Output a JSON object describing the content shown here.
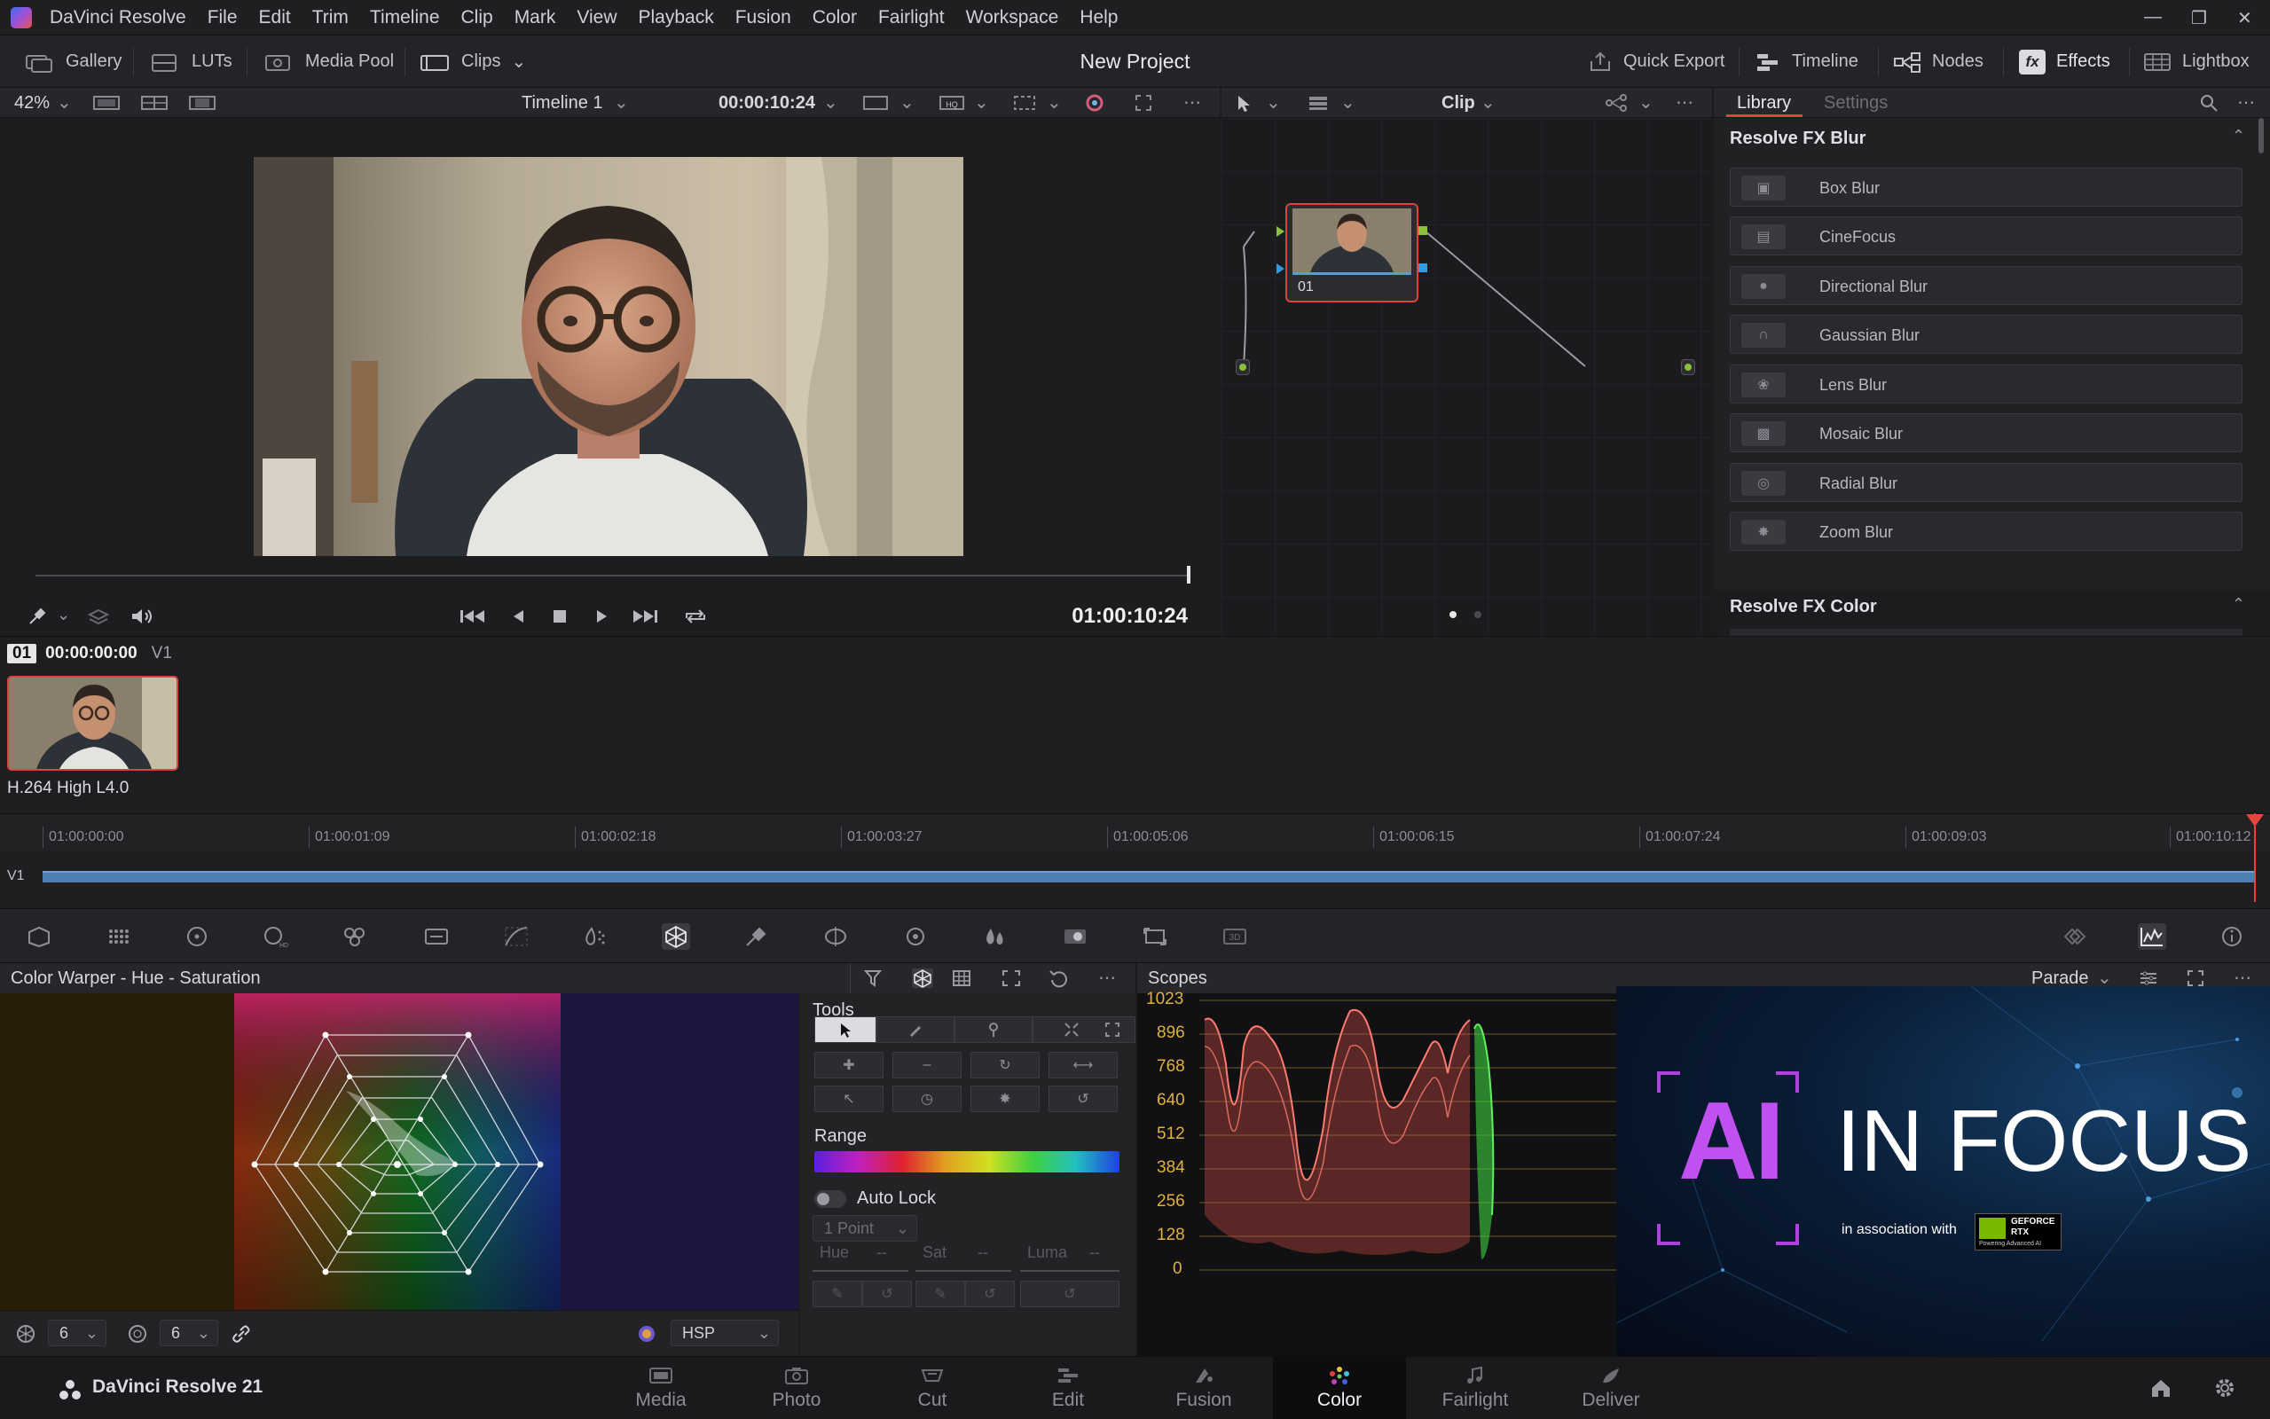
{
  "app": {
    "name": "DaVinci Resolve",
    "menus": [
      "DaVinci Resolve",
      "File",
      "Edit",
      "Trim",
      "Timeline",
      "Clip",
      "Mark",
      "View",
      "Playback",
      "Fusion",
      "Color",
      "Fairlight",
      "Workspace",
      "Help"
    ]
  },
  "toolbar": {
    "gallery": "Gallery",
    "luts": "LUTs",
    "media_pool": "Media Pool",
    "clips": "Clips",
    "project_title": "New Project",
    "quick_export": "Quick Export",
    "timeline": "Timeline",
    "nodes": "Nodes",
    "effects": "Effects",
    "lightbox": "Lightbox"
  },
  "viewer": {
    "zoom": "42%",
    "timeline_name": "Timeline 1",
    "source_tc": "00:00:10:24",
    "current_tc": "01:00:10:24",
    "scrub_position": 1.0
  },
  "nodes": {
    "mode": "Clip",
    "node_label": "01"
  },
  "library": {
    "tabs": [
      "Library",
      "Settings"
    ],
    "active_tab": "Library",
    "sections": [
      {
        "title": "Resolve FX Blur",
        "items": [
          "Box Blur",
          "CineFocus",
          "Directional Blur",
          "Gaussian Blur",
          "Lens Blur",
          "Mosaic Blur",
          "Radial Blur",
          "Zoom Blur"
        ]
      },
      {
        "title": "Resolve FX Color",
        "items": []
      }
    ]
  },
  "clip_strip": {
    "clip_number": "01",
    "clip_tc": "00:00:00:00",
    "track": "V1",
    "codec": "H.264 High L4.0"
  },
  "timeline": {
    "track": "V1",
    "ticks": [
      "01:00:00:00",
      "01:00:01:09",
      "01:00:02:18",
      "01:00:03:27",
      "01:00:05:06",
      "01:00:06:15",
      "01:00:07:24",
      "01:00:09:03",
      "01:00:10:12"
    ]
  },
  "color_warper": {
    "title": "Color Warper - Hue - Saturation",
    "grid_hue": "6",
    "grid_sat": "6",
    "color_space": "HSP",
    "tools_title": "Tools",
    "range_label": "Range",
    "auto_lock": "Auto Lock",
    "point_mode": "1 Point",
    "hue_label": "Hue",
    "sat_label": "Sat",
    "luma_label": "Luma",
    "dash": "--"
  },
  "scopes": {
    "title": "Scopes",
    "mode": "Parade",
    "scale": [
      "1023",
      "896",
      "768",
      "640",
      "512",
      "384",
      "256",
      "128",
      "0"
    ]
  },
  "ad": {
    "title_ai": "AI",
    "title_rest": "IN FOCUS",
    "assoc": "in association with",
    "brand_top": "GEFORCE",
    "brand_bottom": "RTX",
    "tagline": "Powering Advanced AI"
  },
  "pagebar": {
    "product": "DaVinci Resolve 21",
    "pages": [
      "Media",
      "Photo",
      "Cut",
      "Edit",
      "Fusion",
      "Color",
      "Fairlight",
      "Deliver"
    ],
    "active": "Color"
  },
  "colors": {
    "accent_red": "#e5453e",
    "track_blue": "#4f7fb0",
    "bg": "#1c1c1f"
  }
}
